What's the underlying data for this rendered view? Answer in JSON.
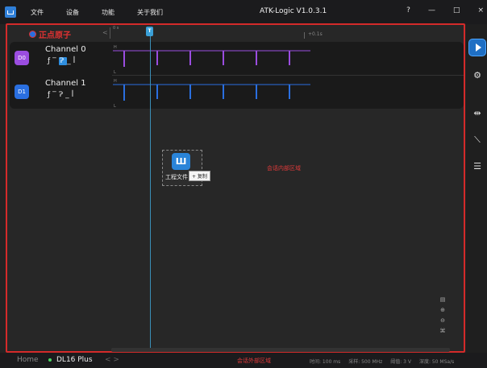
{
  "titlebar": {
    "menu": [
      "文件",
      "设备",
      "功能",
      "关于我们"
    ],
    "title": "ATK-Logic  V1.0.3.1",
    "controls": [
      "?",
      "—",
      "□",
      "×"
    ]
  },
  "logo": {
    "text": "正点原子"
  },
  "ruler": {
    "chevron": "<",
    "start": "0 s",
    "mark": "+0.1s",
    "marker": "T"
  },
  "channels": [
    {
      "badge": "D0",
      "name": "Channel 0",
      "color": "#9b4de0",
      "trigger_symbols": [
        "ƒ",
        "‾",
        "Ɂ",
        "_",
        "ꟾ"
      ],
      "selected_index": 2
    },
    {
      "badge": "D1",
      "name": "Channel 1",
      "color": "#2a6fe0",
      "trigger_symbols": [
        "ƒ",
        "‾",
        "Ɂ",
        "_",
        "ꟾ"
      ],
      "selected_index": -1
    }
  ],
  "signal_levels": {
    "high": "H",
    "low": "L"
  },
  "drag": {
    "icon_text": "Ш",
    "label": "工程文件",
    "tooltip": "+ 复制"
  },
  "annotations": {
    "inner": "会话内部区域",
    "outer": "会话外部区域"
  },
  "zoom_tools": [
    "▤",
    "⊕",
    "⊖",
    "⌘"
  ],
  "sidebar": {
    "icons": [
      "gear-icon",
      "probe-icon",
      "measure-icon",
      "search-list-icon"
    ]
  },
  "bottom": {
    "home": "Home",
    "device": "DL16 Plus",
    "nav": "<  >",
    "status": [
      "时间: 100 ms",
      "采样: 500 MHz",
      "阈值: 3 V",
      "深度: 50 MSa/s"
    ]
  }
}
